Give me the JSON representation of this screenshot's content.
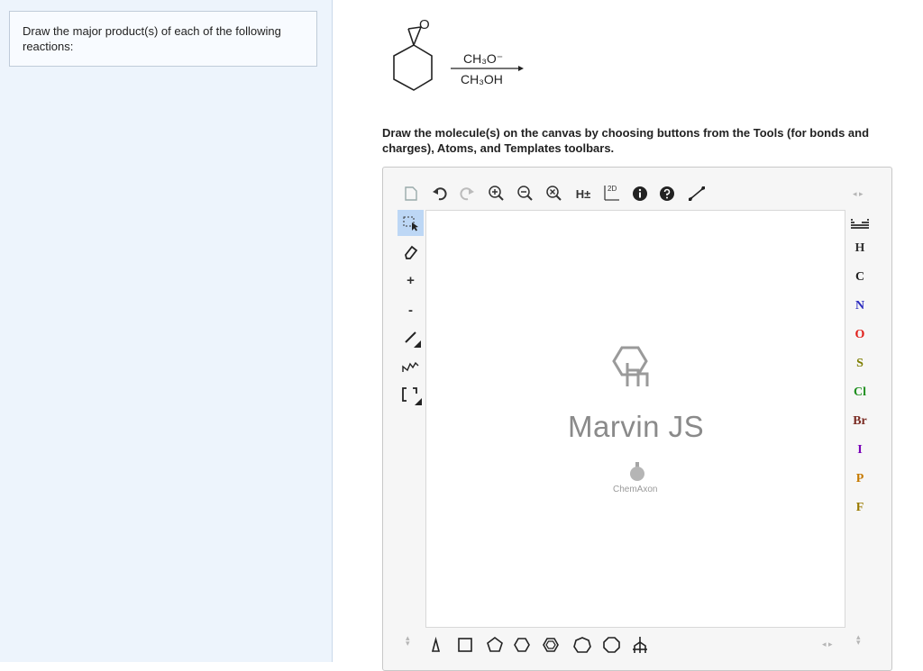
{
  "question": {
    "text": "Draw the major product(s) of each of the following reactions:"
  },
  "reaction": {
    "reagent_top": "CH₃O⁻",
    "reagent_bottom": "CH₃OH",
    "epoxide_oxygen": "O"
  },
  "instructions": {
    "text": "Draw the molecule(s) on the canvas by choosing buttons from the Tools (for bonds and charges), Atoms, and Templates toolbars."
  },
  "toolbar": {
    "hydrogen_label": "H±",
    "twod_label": "2D",
    "plus_label": "+",
    "minus_label": "-"
  },
  "atoms": {
    "H": "H",
    "C": "C",
    "N": "N",
    "O": "O",
    "S": "S",
    "Cl": "Cl",
    "Br": "Br",
    "I": "I",
    "P": "P",
    "F": "F"
  },
  "atom_colors": {
    "H": "#333333",
    "C": "#222222",
    "N": "#2b2bbf",
    "O": "#e0201b",
    "S": "#7d7d00",
    "Cl": "#1f8f1f",
    "Br": "#7a2b22",
    "I": "#7a00b8",
    "P": "#c67a00",
    "F": "#9a7a00"
  },
  "watermark": {
    "product": "Marvin JS",
    "company": "ChemAxon"
  }
}
